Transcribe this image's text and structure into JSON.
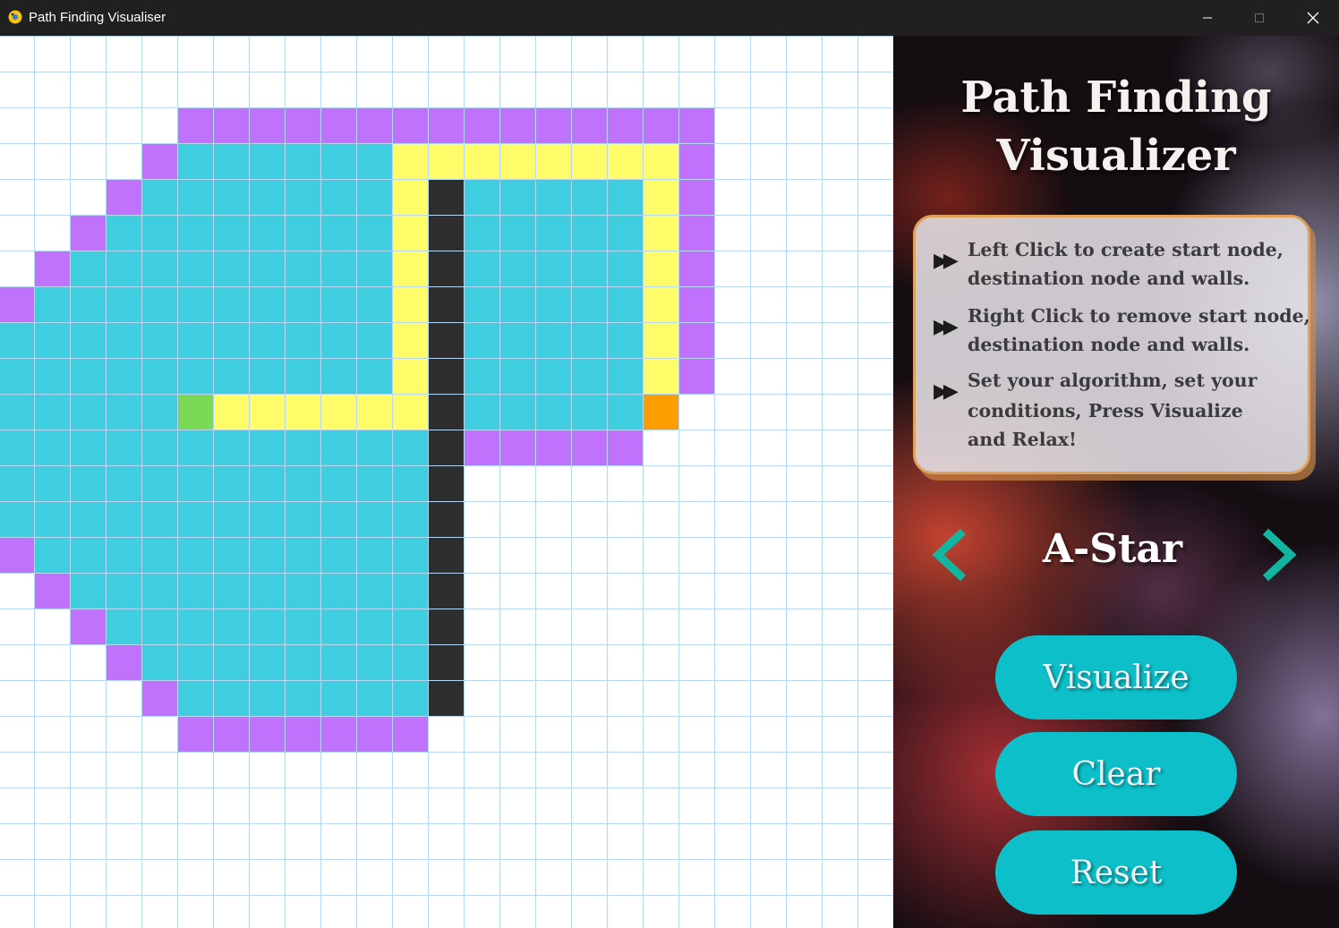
{
  "window": {
    "title": "Path Finding Visualiser",
    "controls": {
      "minimize": "minimize-icon",
      "maximize": "maximize-icon",
      "close": "close-icon"
    }
  },
  "grid": {
    "cell_colors": {
      "empty": "#ffffff",
      "grid_line": "#b7d8f2",
      "open": "#c172fc",
      "closed": "#3fcee0",
      "path": "#fffc6a",
      "wall": "#2e2e2e",
      "start": "#7ad957",
      "end": "#fd9d00"
    },
    "rows": [
      "                         ",
      "                         ",
      "     OOOOOOOOOOOOOOO      ",
      "    OCCCCCCPPPPPPPPO     ",
      "   OCCCCCCCPWCCCCCPO     ",
      "  OCCCCCCCCPWCCCCCPO     ",
      " OCCCCCCCCCPWCCCCCPO     ",
      "OCCCCCCCCCCPWCCCCCPO     ",
      "CCCCCCCCCCCPWCCCCCPO     ",
      "CCCCCCCCCCCPWCCCCCPO     ",
      "CCCCCSPPPPPPWCCCCCE      ",
      "CCCCCCCCCCCCWOOOOO       ",
      "CCCCCCCCCCCCW            ",
      "CCCCCCCCCCCCW            ",
      "OCCCCCCCCCCCW            ",
      " OCCCCCCCCCCW            ",
      "  OCCCCCCCCCW            ",
      "   OCCCCCCCCW            ",
      "    OCCCCCCCW            ",
      "     OOOOOOO             ",
      "                         ",
      "                         ",
      "                         ",
      "                         ",
      "                         "
    ],
    "legend_codes": {
      " ": "empty",
      "O": "open",
      "C": "closed",
      "P": "path",
      "W": "wall",
      "S": "start",
      "E": "end"
    }
  },
  "panel": {
    "title_line1": "Path Finding",
    "title_line2": "Visualizer",
    "instructions": [
      {
        "bullet": "▶▶",
        "lines": [
          "Left Click to create start node,",
          "destination node and walls."
        ]
      },
      {
        "bullet": "▶▶",
        "lines": [
          "Right Click to remove start node,",
          "destination node and walls."
        ]
      },
      {
        "bullet": "▶▶",
        "lines": [
          "Set your algorithm, set your",
          "conditions, Press Visualize",
          " and Relax!"
        ]
      }
    ],
    "algorithm": "A-Star",
    "algo_prev_icon": "chevron-left-icon",
    "algo_next_icon": "chevron-right-icon",
    "arrow_color": "#12b5a0",
    "buttons": {
      "visualize": "Visualize",
      "clear": "Clear",
      "reset": "Reset"
    },
    "button_color": "#0cbfc9"
  }
}
